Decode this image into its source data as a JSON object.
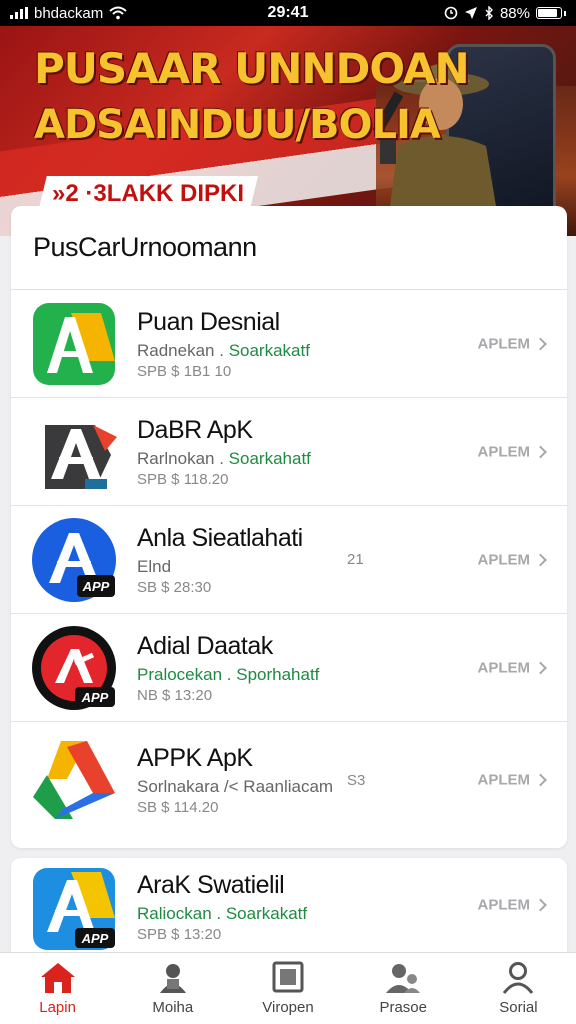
{
  "status_bar": {
    "carrier": "bhdackam",
    "time": "29:41",
    "battery": "88%",
    "battery_level": 0.88
  },
  "banner": {
    "line1": "PUSAAR UNNDOAN",
    "line2": "ADSAINDUU/BOLIA",
    "tag": "»2 ·3LAKK DIPKI"
  },
  "list": {
    "title": "PusCarUrnoomann",
    "items": [
      {
        "name": "Puan Desnial",
        "developer": "Radnekan",
        "category": "Soarkakatf",
        "meta": "SPB  $ 1B1 10",
        "extra": "",
        "action": "APLEM",
        "icon": "a-green-icon"
      },
      {
        "name": "DaBR ApK",
        "developer": "Rarlnokan",
        "category": "Soarkahatf",
        "meta": "SPB  $ 118.20",
        "extra": "",
        "action": "APLEM",
        "icon": "a-dark-icon"
      },
      {
        "name": "Anla Sieatlahati",
        "developer": "Elnd",
        "category": "",
        "meta": "SB  $ 28:30",
        "extra": "21",
        "action": "APLEM",
        "icon": "a-blue-app-icon"
      },
      {
        "name": "Adial Daatak",
        "developer": "Pralocekan",
        "category": "Sporhahatf",
        "meta": "NB  $ 13:20",
        "extra": "",
        "action": "APLEM",
        "icon": "a-red-circle-icon"
      },
      {
        "name": "APPK ApK",
        "developer": "Sorlnakara /< Raanliacam",
        "category": "",
        "meta": "SB  $ 114.20",
        "extra": "S3",
        "action": "APLEM",
        "icon": "gdrive-triangle-icon"
      }
    ],
    "second_item": {
      "name": "AraK Swatielil",
      "developer": "Raliockan",
      "category": "Soarkakatf",
      "meta": "SPB  $ 13:20",
      "action": "APLEM",
      "icon": "a-blue-yellow-app-icon"
    }
  },
  "tabs": [
    {
      "label": "Lapin",
      "icon": "home-icon",
      "active": true
    },
    {
      "label": "Moiha",
      "icon": "lock-user-icon",
      "active": false
    },
    {
      "label": "Viropen",
      "icon": "square-frame-icon",
      "active": false
    },
    {
      "label": "Prasoe",
      "icon": "group-icon",
      "active": false
    },
    {
      "label": "Sorial",
      "icon": "person-icon",
      "active": false
    }
  ],
  "colors": {
    "accent": "#d9231c",
    "category_green": "#1e8b42",
    "banner_gold": "#f6c22d"
  }
}
